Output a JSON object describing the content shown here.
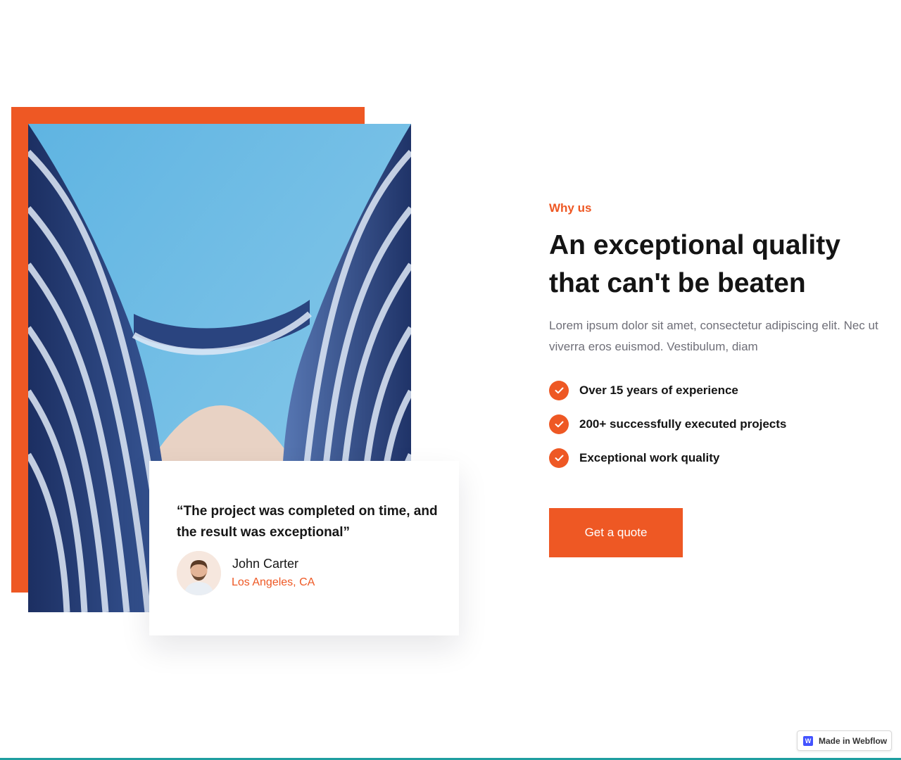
{
  "colors": {
    "accent": "#ee5824",
    "heading": "#141414",
    "body_text": "#6f6f78",
    "background": "#ffffff"
  },
  "media": {
    "photo_icon": "building-photo",
    "avatar_icon": "person-avatar"
  },
  "testimonial": {
    "quote": "“The project was completed on time, and the result was exceptional”",
    "author_name": "John Carter",
    "author_location": "Los Angeles, CA"
  },
  "about": {
    "eyebrow": "Why us",
    "heading": "An exceptional quality that can't be beaten",
    "lead": "Lorem ipsum dolor sit amet, consectetur adipiscing elit. Nec ut viverra eros euismod. Vestibulum, diam",
    "features": [
      {
        "label": "Over 15 years of experience",
        "icon": "check-icon"
      },
      {
        "label": "200+ successfully executed projects",
        "icon": "check-icon"
      },
      {
        "label": "Exceptional work quality",
        "icon": "check-icon"
      }
    ],
    "cta_label": "Get a quote"
  },
  "webflow_badge": {
    "label": "Made in Webflow",
    "icon_letter": "W"
  }
}
